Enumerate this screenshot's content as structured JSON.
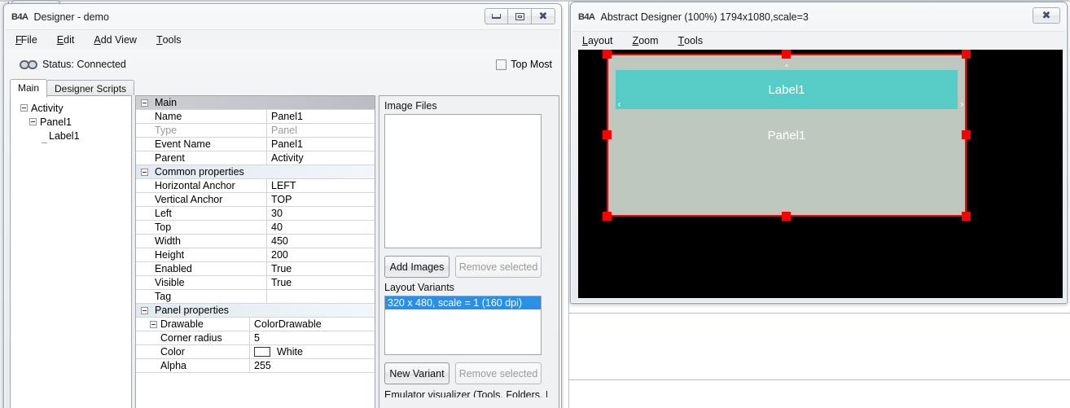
{
  "background": {
    "note": "desktop / underlying IDE window edges"
  },
  "designer_window": {
    "logo": "B4A",
    "title": "Designer - demo",
    "caption_buttons": [
      {
        "name": "minimize",
        "glyph": "minimize-icon"
      },
      {
        "name": "maximize",
        "glyph": "maximize-icon"
      },
      {
        "name": "close",
        "glyph": "close-icon"
      }
    ],
    "menu": [
      {
        "label": "File",
        "accel": "F"
      },
      {
        "label": "Edit",
        "accel": "E"
      },
      {
        "label": "Add View",
        "accel": "A"
      },
      {
        "label": "Tools",
        "accel": "T"
      }
    ],
    "status": {
      "icon": "chain-link-icon",
      "text": "Status: Connected"
    },
    "top_most": {
      "label": "Top Most",
      "checked": false
    },
    "tabs": [
      {
        "label": "Main",
        "active": true
      },
      {
        "label": "Designer Scripts",
        "active": false
      }
    ],
    "tree": {
      "nodes": [
        {
          "label": "Activity",
          "depth": 0,
          "expander": true
        },
        {
          "label": "Panel1",
          "depth": 1,
          "expander": true
        },
        {
          "label": "Label1",
          "depth": 2,
          "expander": false
        }
      ]
    },
    "properties": [
      {
        "kind": "category",
        "name": "Main",
        "expander": true
      },
      {
        "kind": "row",
        "name": "Name",
        "value": "Panel1"
      },
      {
        "kind": "row",
        "name": "Type",
        "value": "Panel",
        "disabled": true
      },
      {
        "kind": "row",
        "name": "Event Name",
        "value": "Panel1"
      },
      {
        "kind": "row",
        "name": "Parent",
        "value": "Activity"
      },
      {
        "kind": "category2",
        "name": "Common properties",
        "expander": true
      },
      {
        "kind": "row",
        "name": "Horizontal Anchor",
        "value": "LEFT"
      },
      {
        "kind": "row",
        "name": "Vertical Anchor",
        "value": "TOP"
      },
      {
        "kind": "row",
        "name": "Left",
        "value": "30"
      },
      {
        "kind": "row",
        "name": "Top",
        "value": "40"
      },
      {
        "kind": "row",
        "name": "Width",
        "value": "450"
      },
      {
        "kind": "row",
        "name": "Height",
        "value": "200"
      },
      {
        "kind": "row",
        "name": "Enabled",
        "value": "True"
      },
      {
        "kind": "row",
        "name": "Visible",
        "value": "True"
      },
      {
        "kind": "row",
        "name": "Tag",
        "value": ""
      },
      {
        "kind": "category2",
        "name": "Panel properties",
        "expander": true
      },
      {
        "kind": "subexp",
        "name": "Drawable",
        "value": "ColorDrawable"
      },
      {
        "kind": "sub",
        "name": "Corner radius",
        "value": "5"
      },
      {
        "kind": "sub",
        "name": "Color",
        "value": "White",
        "swatch": "#ffffff"
      },
      {
        "kind": "sub",
        "name": "Alpha",
        "value": "255"
      }
    ],
    "image_files": {
      "label": "Image Files",
      "items": [],
      "add_button": "Add Images",
      "remove_button": "Remove selected",
      "remove_enabled": false
    },
    "layout_variants": {
      "label": "Layout Variants",
      "items": [
        "320 x 480, scale = 1 (160 dpi)"
      ],
      "selected_index": 0,
      "new_button": "New Variant",
      "remove_button": "Remove selected",
      "remove_enabled": false
    },
    "clipped_footer_text": "Emulator visualizer (Tools, Folders, Preview)"
  },
  "abstract_designer_window": {
    "logo": "B4A",
    "title": "Abstract Designer (100%) 1794x1080,scale=3",
    "caption_buttons": [
      {
        "name": "close",
        "glyph": "close-icon"
      }
    ],
    "menu": [
      {
        "label": "Layout",
        "accel": "L"
      },
      {
        "label": "Zoom",
        "accel": "Z"
      },
      {
        "label": "Tools",
        "accel": "T"
      }
    ],
    "canvas": {
      "background_color": "#000000",
      "panel": {
        "name": "Panel1",
        "text": "Panel1",
        "fill_color": "#bfc8bf",
        "text_color": "#ffffff",
        "selected": true,
        "selection_color": "#ff0000"
      },
      "label": {
        "name": "Label1",
        "text": "Label1",
        "fill_color": "#55ccc5",
        "text_color": "#ffffff"
      },
      "anchor_arrows": {
        "left": "‹",
        "right": "›",
        "up": "˄",
        "down": "˅"
      }
    }
  }
}
